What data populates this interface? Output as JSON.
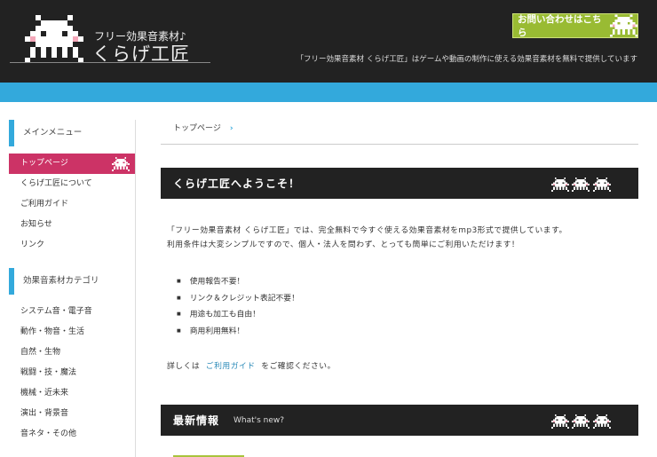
{
  "header": {
    "logo_sub": "フリー効果音素材♪",
    "logo_main": "くらげ工匠",
    "tagline": "「フリー効果音素材 くらげ工匠」はゲームや動画の制作に使える効果音素材を無料で提供しています",
    "contact_label": "お問い合わせはこちら"
  },
  "colors": {
    "header": "#222222",
    "band": "#33a9dc",
    "active": "#cc3366",
    "contact": "#99bb33"
  },
  "sidebar": {
    "main_title": "メインメニュー",
    "main_items": [
      {
        "label": "トップページ",
        "active": true
      },
      {
        "label": "くらげ工匠について"
      },
      {
        "label": "ご利用ガイド"
      },
      {
        "label": "お知らせ"
      },
      {
        "label": "リンク"
      }
    ],
    "cat_title": "効果音素材カテゴリ",
    "cat_items": [
      {
        "label": "システム音・電子音"
      },
      {
        "label": "動作・物音・生活"
      },
      {
        "label": "自然・生物"
      },
      {
        "label": "戦闘・技・魔法"
      },
      {
        "label": "機械・近未来"
      },
      {
        "label": "演出・背景音"
      },
      {
        "label": "音ネタ・その他"
      }
    ]
  },
  "main": {
    "breadcrumb": "トップページ",
    "welcome_title": "くらげ工匠へようこそ！",
    "intro1": "「フリー効果音素材 くらげ工匠」では、完全無料で今すぐ使える効果音素材をmp3形式で提供しています。",
    "intro2": "利用条件は大変シンプルですので、個人・法人を問わず、とっても簡単にご利用いただけます！",
    "bullets": [
      "使用報告不要！",
      "リンク＆クレジット表記不要！",
      "用途も加工も自由！",
      "商用利用無料！"
    ],
    "guide_pre": "詳しくは",
    "guide_link": "ご利用ガイド",
    "guide_post": "をご確認ください。",
    "news_title": "最新情報",
    "news_en": "What's new?"
  }
}
